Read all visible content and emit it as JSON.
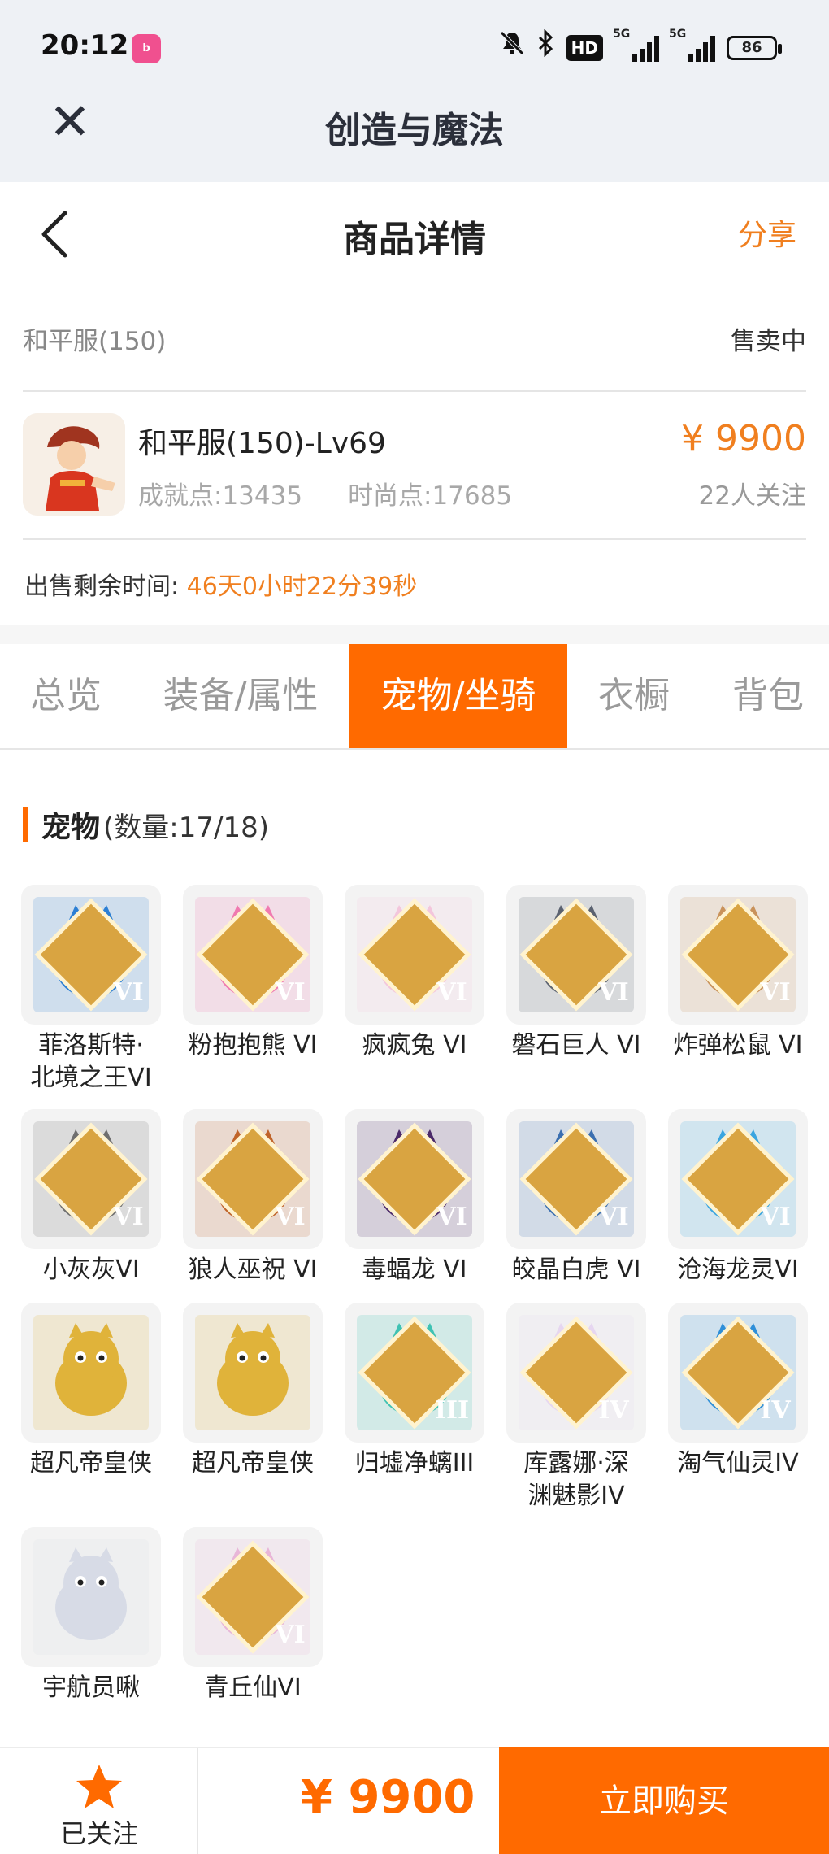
{
  "status_bar": {
    "time": "20:12",
    "app_badge": "bilibili",
    "hd_label": "HD",
    "signal1_label": "5G",
    "signal2_label": "5G",
    "battery": "86"
  },
  "app_bar": {
    "title": "创造与魔法",
    "close_icon": "close-icon"
  },
  "page_header": {
    "title": "商品详情",
    "share_label": "分享",
    "back_icon": "back-chevron-icon"
  },
  "listing": {
    "server": "和平服(150)",
    "status": "售卖中",
    "title": "和平服(150)-Lv69",
    "achievement": "成就点:13435",
    "fashion": "时尚点:17685",
    "price": "¥ 9900",
    "followers": "22人关注",
    "remaining_label": "出售剩余时间:",
    "remaining_value": "46天0小时22分39秒"
  },
  "tabs": [
    {
      "label": "总览"
    },
    {
      "label": "装备/属性"
    },
    {
      "label": "宠物/坐骑"
    },
    {
      "label": "衣橱"
    },
    {
      "label": "背包"
    }
  ],
  "active_tab": "宠物/坐骑",
  "section": {
    "name": "宠物",
    "count": "(数量:17/18)"
  },
  "pets": [
    {
      "name": "菲洛斯特·",
      "name2": "北境之王VI",
      "grade": "VI",
      "color": "#2c7fd4",
      "icon": "ice-king-icon"
    },
    {
      "name": "粉抱抱熊 VI",
      "name2": "",
      "grade": "VI",
      "color": "#f07ab0",
      "icon": "pink-bear-icon"
    },
    {
      "name": "疯疯兔 VI",
      "name2": "",
      "grade": "VI",
      "color": "#f3c6dc",
      "icon": "crazy-rabbit-icon"
    },
    {
      "name": "磐石巨人 VI",
      "name2": "",
      "grade": "VI",
      "color": "#5b6270",
      "icon": "rock-giant-icon"
    },
    {
      "name": "炸弹松鼠 VI",
      "name2": "",
      "grade": "VI",
      "color": "#c9925a",
      "icon": "bomb-squirrel-icon"
    },
    {
      "name": "小灰灰VI",
      "name2": "",
      "grade": "VI",
      "color": "#6f6f6f",
      "icon": "gray-wolf-icon"
    },
    {
      "name": "狼人巫祝 VI",
      "name2": "",
      "grade": "VI",
      "color": "#c0642a",
      "icon": "werewolf-shaman-icon"
    },
    {
      "name": "毒蝠龙 VI",
      "name2": "",
      "grade": "VI",
      "color": "#4b2a6a",
      "icon": "poison-bat-dragon-icon"
    },
    {
      "name": "皎晶白虎 VI",
      "name2": "",
      "grade": "VI",
      "color": "#3b6fb0",
      "icon": "white-tiger-icon"
    },
    {
      "name": "沧海龙灵VI",
      "name2": "",
      "grade": "VI",
      "color": "#3aa5e0",
      "icon": "sea-dragon-spirit-icon"
    },
    {
      "name": "超凡帝皇侠",
      "name2": "",
      "grade": "",
      "color": "#e0b33a",
      "icon": "emperor-hero-icon"
    },
    {
      "name": "超凡帝皇侠",
      "name2": "",
      "grade": "",
      "color": "#e0b33a",
      "icon": "emperor-hero-icon"
    },
    {
      "name": "归墟净螭III",
      "name2": "",
      "grade": "III",
      "color": "#3fc2b3",
      "icon": "jade-dragon-icon"
    },
    {
      "name": "库露娜·深",
      "name2": "渊魅影IV",
      "grade": "IV",
      "color": "#e6d6f0",
      "icon": "kuruna-icon"
    },
    {
      "name": "淘气仙灵IV",
      "name2": "",
      "grade": "IV",
      "color": "#2f8fd8",
      "icon": "naughty-fairy-icon"
    },
    {
      "name": "宇航员啾",
      "name2": "",
      "grade": "",
      "color": "#d7dbe6",
      "icon": "astronaut-icon"
    },
    {
      "name": "青丘仙VI",
      "name2": "",
      "grade": "VI",
      "color": "#e8b6d8",
      "icon": "qingqiu-fox-icon"
    }
  ],
  "bottom_bar": {
    "follow_label": "已关注",
    "price": "¥ 9900",
    "buy_label": "立即购买",
    "follow_icon": "star-icon"
  },
  "colors": {
    "accent": "#ff6a00",
    "price": "#f07f1f",
    "grade_badge": "#d9a441"
  }
}
